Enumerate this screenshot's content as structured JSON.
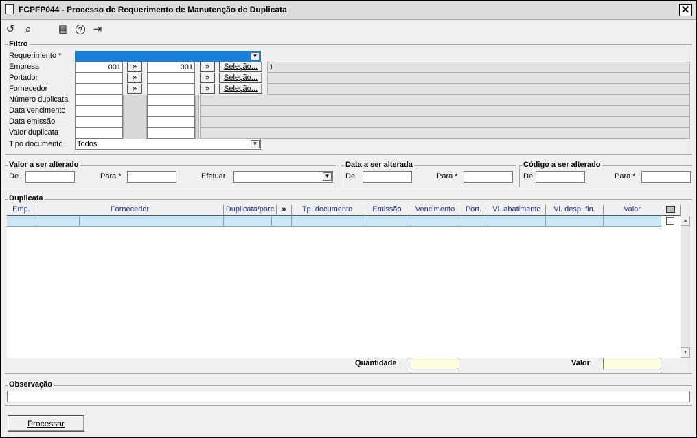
{
  "window": {
    "title": "FCPFP044 - Processo de Requerimento de Manutenção de Duplicata",
    "close_glyph": "✕"
  },
  "toolbar": {
    "icons": [
      "undo-icon",
      "search-icon",
      "calendar-icon",
      "help-icon",
      "exit-icon"
    ],
    "glyphs": {
      "undo": "↺",
      "search": "⌕",
      "calendar": "▦",
      "help": "?",
      "exit": "⇥"
    }
  },
  "filtro": {
    "legend": "Filtro",
    "requerimento": {
      "label": "Requerimento *",
      "value": ""
    },
    "empresa": {
      "label": "Empresa",
      "from": "001",
      "to": "001",
      "description": "1"
    },
    "portador": {
      "label": "Portador",
      "from": "",
      "to": "",
      "description": ""
    },
    "fornecedor": {
      "label": "Fornecedor",
      "from": "",
      "to": "",
      "description": ""
    },
    "numero_duplicata": {
      "label": "Número duplicata",
      "from": "",
      "to": ""
    },
    "data_vencimento": {
      "label": "Data vencimento",
      "from": "",
      "to": ""
    },
    "data_emissao": {
      "label": "Data emissão",
      "from": "",
      "to": ""
    },
    "valor_duplicata": {
      "label": "Valor duplicata",
      "from": "",
      "to": ""
    },
    "tipo_documento": {
      "label": "Tipo documento",
      "value": "Todos"
    },
    "arrow_label": "»",
    "selecao_label": "Seleção..."
  },
  "valor_alterado": {
    "legend": "Valor a ser alterado",
    "de_label": "De",
    "para_label": "Para *",
    "efetuar_label": "Efetuar",
    "de": "",
    "para": "",
    "efetuar": ""
  },
  "data_alterada": {
    "legend": "Data a ser alterada",
    "de_label": "De",
    "para_label": "Para *",
    "de": "",
    "para": ""
  },
  "codigo_alterado": {
    "legend": "Código a ser alterado",
    "de_label": "De",
    "para_label": "Para *",
    "de": "",
    "para": ""
  },
  "duplicata": {
    "legend": "Duplicata",
    "columns": [
      "Emp.",
      "Fornecedor",
      "Duplicata/parc",
      "»",
      "Tp. documento",
      "Emissão",
      "Vencimento",
      "Port.",
      "Vl. abatimento",
      "Vl. desp. fin.",
      "Valor"
    ],
    "quantidade_label": "Quantidade",
    "valor_label": "Valor",
    "quantidade": "",
    "valor": ""
  },
  "observacao": {
    "legend": "Observação",
    "value": ""
  },
  "processar_label": "Processar"
}
